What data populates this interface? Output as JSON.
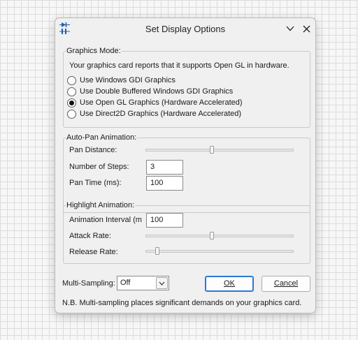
{
  "window": {
    "title": "Set Display Options"
  },
  "icons": {
    "app": "schematic-app-icon",
    "minimize": "chevron-down-icon",
    "close": "close-icon",
    "dropdown": "chevron-down-icon"
  },
  "graphics_mode": {
    "legend": "Graphics Mode:",
    "info": "Your graphics card reports that it supports Open GL in hardware.",
    "options": [
      {
        "label": "Use Windows GDI Graphics",
        "checked": false
      },
      {
        "label": "Use Double Buffered Windows GDI Graphics",
        "checked": false
      },
      {
        "label": "Use Open GL Graphics (Hardware Accelerated)",
        "checked": true
      },
      {
        "label": "Use Direct2D Graphics (Hardware Accelerated)",
        "checked": false
      }
    ]
  },
  "auto_pan": {
    "legend": "Auto-Pan Animation:",
    "pan_distance_label": "Pan Distance:",
    "pan_distance_level": 0.45,
    "steps_label": "Number of Steps:",
    "steps_value": "3",
    "pan_time_label": "Pan Time (ms):",
    "pan_time_value": "100"
  },
  "highlight": {
    "legend": "Highlight Animation:",
    "interval_label": "Animation Interval (m",
    "interval_value": "100",
    "attack_label": "Attack Rate:",
    "attack_level": 0.45,
    "release_label": "Release Rate:",
    "release_level": 0.08
  },
  "multisampling": {
    "label": "Multi-Sampling:",
    "value": "Off",
    "note": "N.B. Multi-sampling places significant demands on your graphics card."
  },
  "buttons": {
    "ok": "OK",
    "cancel": "Cancel"
  },
  "colors": {
    "accent": "#2b78d6",
    "dialog_bg": "#f0f0f0"
  }
}
